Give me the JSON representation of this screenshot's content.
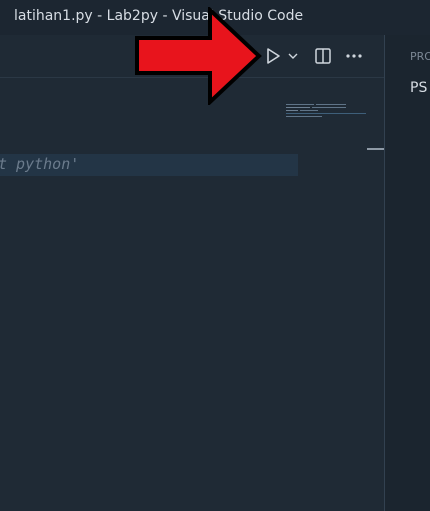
{
  "window": {
    "title": "latihan1.py - Lab2py - Visual Studio Code"
  },
  "toolbar": {
    "run_icon": "play-icon",
    "run_dropdown_icon": "chevron-down-icon",
    "split_icon": "split-editor-icon",
    "more_icon": "ellipsis-icon"
  },
  "editor": {
    "visible_line": "t python'"
  },
  "panel": {
    "tab_label": "PRO",
    "prompt": "PS"
  },
  "annotation": {
    "color": "#e8141c",
    "icon": "red-arrow-icon"
  },
  "colors": {
    "background": "#1f2a35",
    "titlebar": "#1c2631",
    "highlight": "#233546"
  }
}
